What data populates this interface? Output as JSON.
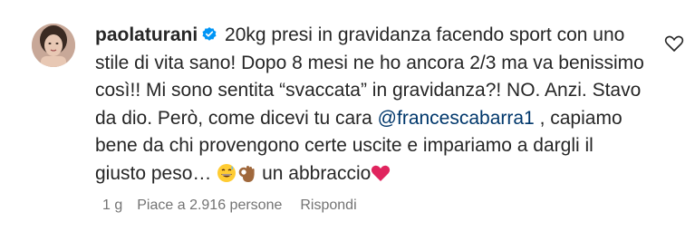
{
  "comment": {
    "username": "paolaturani",
    "text_1": "20kg presi in gravidanza facendo sport con uno stile di vita sano! Dopo 8 mesi ne ho ancora 2/3 ma va benissimo così!! Mi sono sentita “svaccata” in gravidanza?! NO. Anzi. Stavo da dio. Però, come dicevi tu cara ",
    "mention": "@francescabarra1",
    "text_2": " , capiamo bene da chi provengono certe uscite e impariamo a dargli il giusto peso… ",
    "text_3": " un abbraccio",
    "age": "1 g",
    "likes": "Piace a 2.916 persone",
    "reply": "Rispondi"
  },
  "icons": [
    "verified-badge-icon",
    "grinning-sweat-emoji",
    "ok-hand-emoji",
    "red-heart-emoji",
    "heart-outline-icon"
  ],
  "colors": {
    "verified": "#0095f6",
    "mention": "#00376b",
    "meta": "#737373",
    "heart": "#e0245e"
  }
}
